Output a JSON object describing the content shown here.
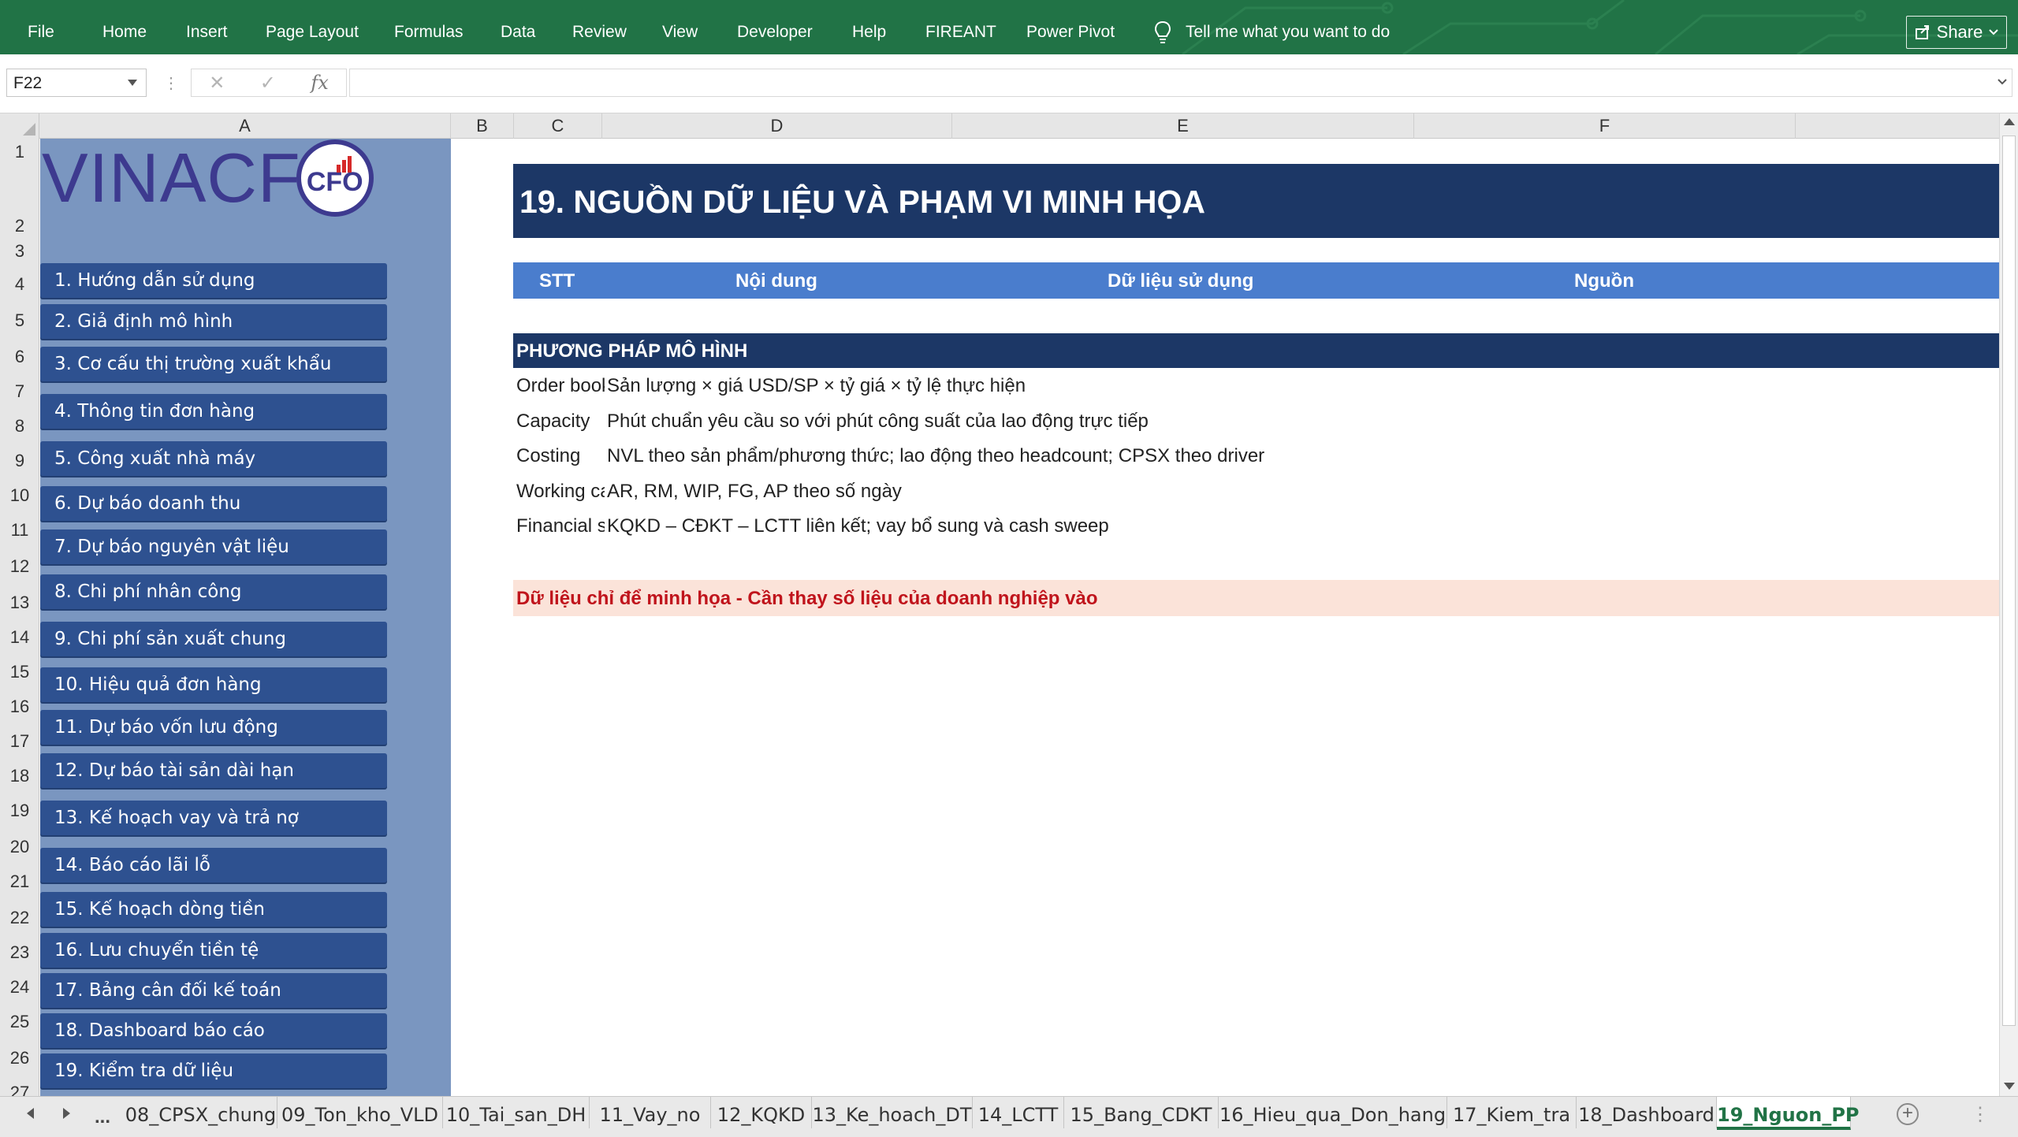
{
  "ribbon": {
    "tabs": [
      "File",
      "Home",
      "Insert",
      "Page Layout",
      "Formulas",
      "Data",
      "Review",
      "View",
      "Developer",
      "Help",
      "FIREANT",
      "Power Pivot"
    ],
    "tell_me": "Tell me what you want to do",
    "share_label": "Share",
    "accent_color": "#217346"
  },
  "formula_bar": {
    "name_box": "F22",
    "formula_value": "",
    "fx_label": "fx"
  },
  "grid": {
    "columns": [
      "A",
      "B",
      "C",
      "D",
      "E",
      "F"
    ],
    "rows": [
      "1",
      "2",
      "3",
      "4",
      "5",
      "6",
      "7",
      "8",
      "9",
      "10",
      "11",
      "12",
      "13",
      "14",
      "15",
      "16",
      "17",
      "18",
      "19",
      "20",
      "21",
      "22",
      "23",
      "24",
      "25",
      "26",
      "27"
    ]
  },
  "logo": {
    "text": "VINACF",
    "badge": "CFO"
  },
  "nav": {
    "items": [
      "1. Hướng dẫn sử dụng",
      "2. Giả định mô hình",
      "3. Cơ cấu thị trường xuất khẩu",
      "4. Thông tin đơn hàng",
      "5. Công xuất nhà máy",
      "6. Dự báo doanh thu",
      "7. Dự báo nguyên vật liệu",
      "8. Chi phí nhân công",
      "9. Chi phí sản xuất chung",
      "10. Hiệu quả đơn hàng",
      "11. Dự báo vốn lưu động",
      "12. Dự báo tài sản dài hạn",
      "13. Kế hoạch vay và trả nợ",
      "14. Báo cáo lãi lỗ",
      "15. Kế hoạch dòng tiền",
      "16. Lưu chuyển tiền tệ",
      "17. Bảng cân đối kế toán",
      "18. Dashboard báo cáo",
      "19. Kiểm tra dữ liệu"
    ],
    "panel_color": "#7a96c0",
    "button_color": "#2e5190"
  },
  "sheet": {
    "title": "19. NGUỒN DỮ LIỆU VÀ PHẠM VI MINH HỌA",
    "table_headers": {
      "stt": "STT",
      "content": "Nội dung",
      "data_used": "Dữ liệu sử dụng",
      "source": "Nguồn"
    },
    "section_title": "PHƯƠNG PHÁP MÔ HÌNH",
    "methods": [
      {
        "label": "Order book",
        "value": "Sản lượng × giá USD/SP × tỷ giá × tỷ lệ thực hiện"
      },
      {
        "label": "Capacity",
        "value": "Phút chuẩn yêu cầu so với phút công suất của lao động trực tiếp"
      },
      {
        "label": "Costing",
        "value": "NVL theo sản phẩm/phương thức; lao động theo headcount; CPSX theo driver"
      },
      {
        "label": "Working capital",
        "value": "AR, RM, WIP, FG, AP theo số ngày"
      },
      {
        "label": "Financial statements",
        "value": "KQKD – CĐKT – LCTT liên kết; vay bổ sung và cash sweep"
      }
    ],
    "note": "Dữ liệu chỉ để minh họa - Cần thay số liệu của doanh nghiệp vào",
    "title_color": "#1c3766",
    "header_color": "#4a7dcd",
    "note_bg": "#fbe3d9",
    "note_color": "#c0141c"
  },
  "tabs": {
    "ellipsis": "...",
    "sheets": [
      "08_CPSX_chung",
      "09_Ton_kho_VLD",
      "10_Tai_san_DH",
      "11_Vay_no",
      "12_KQKD",
      "13_Ke_hoach_DT",
      "14_LCTT",
      "15_Bang_CDKT",
      "16_Hieu_qua_Don_hang",
      "17_Kiem_tra",
      "18_Dashboard",
      "19_Nguon_PP"
    ],
    "active": "19_Nguon_PP",
    "add_label": "+"
  }
}
